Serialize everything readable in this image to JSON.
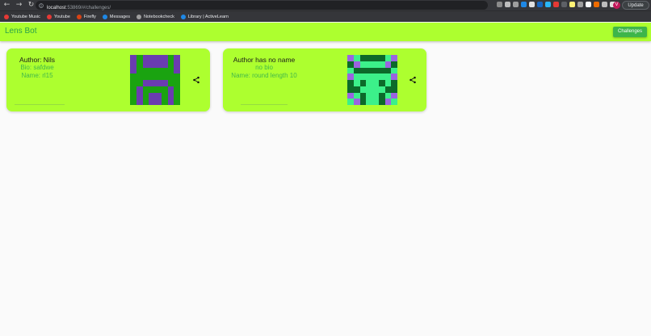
{
  "browser": {
    "url_host": "localhost",
    "url_path": ":53869/#/challenges/",
    "avatar_letter": "V",
    "update_label": "Update",
    "nav_back": "←",
    "nav_forward": "→",
    "nav_reload": "↻",
    "bookmarks": [
      {
        "label": "Youtube Music",
        "color": "#e53935"
      },
      {
        "label": "Youtube",
        "color": "#e53935"
      },
      {
        "label": "Firefly",
        "color": "#d84315"
      },
      {
        "label": "Messages",
        "color": "#1e88e5"
      },
      {
        "label": "Notebookcheck",
        "color": "#9e9e9e"
      },
      {
        "label": "Library | ActiveLearn",
        "color": "#1e88e5"
      }
    ]
  },
  "app": {
    "title": "Lens Bot",
    "challenges_button": "Challenges"
  },
  "cards": [
    {
      "author": "Author: Nils",
      "bio": "Bio: safdwe",
      "name": "Name: rl15",
      "grid_colors": [
        "#6a3cb0",
        "#1aa310"
      ],
      "grid": [
        [
          0,
          1,
          0,
          0,
          0,
          0,
          1,
          0
        ],
        [
          0,
          1,
          0,
          0,
          0,
          0,
          1,
          0
        ],
        [
          0,
          1,
          1,
          1,
          1,
          1,
          1,
          0
        ],
        [
          1,
          1,
          1,
          1,
          1,
          1,
          1,
          1
        ],
        [
          1,
          1,
          0,
          0,
          0,
          0,
          1,
          1
        ],
        [
          1,
          0,
          1,
          1,
          1,
          1,
          0,
          1
        ],
        [
          1,
          0,
          1,
          0,
          0,
          1,
          0,
          1
        ],
        [
          1,
          0,
          1,
          0,
          0,
          1,
          0,
          1
        ]
      ]
    },
    {
      "author": "Author has no name",
      "bio": "no bio",
      "name": "Name: round length 10",
      "grid_colors": [
        "#9a64e0",
        "#3cf08a",
        "#0c6a2a"
      ],
      "grid": [
        [
          0,
          1,
          2,
          2,
          2,
          2,
          1,
          0
        ],
        [
          2,
          0,
          1,
          1,
          1,
          1,
          0,
          2
        ],
        [
          1,
          2,
          2,
          2,
          2,
          2,
          2,
          1
        ],
        [
          0,
          1,
          1,
          1,
          1,
          1,
          1,
          0
        ],
        [
          2,
          1,
          2,
          1,
          1,
          2,
          1,
          2
        ],
        [
          2,
          2,
          1,
          1,
          1,
          1,
          2,
          2
        ],
        [
          0,
          1,
          2,
          1,
          1,
          2,
          1,
          0
        ],
        [
          1,
          0,
          2,
          1,
          1,
          2,
          0,
          1
        ]
      ]
    }
  ]
}
